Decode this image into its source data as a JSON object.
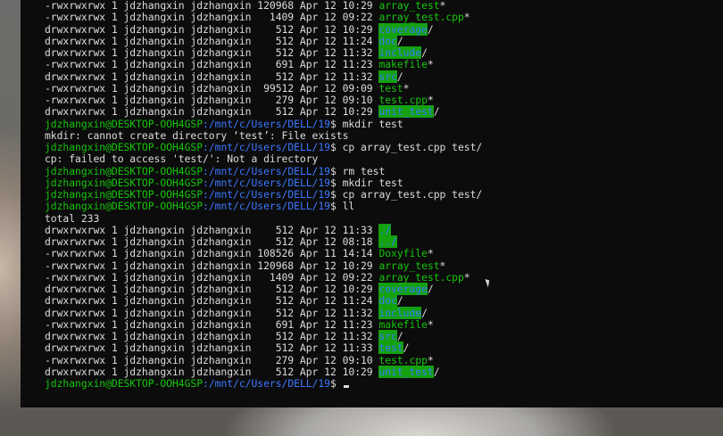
{
  "terminal": {
    "lines": [
      {
        "kind": "entry",
        "meta": "-rwxrwxrwx 1 jdzhangxin jdzhangxin 120968 Apr 12 10:29 ",
        "name": "array_test",
        "ftype": "exec",
        "suffix": "*"
      },
      {
        "kind": "entry",
        "meta": "-rwxrwxrwx 1 jdzhangxin jdzhangxin   1409 Apr 12 09:22 ",
        "name": "array_test.cpp",
        "ftype": "exec",
        "suffix": "*"
      },
      {
        "kind": "entry",
        "meta": "drwxrwxrwx 1 jdzhangxin jdzhangxin    512 Apr 12 10:29 ",
        "name": "coverage",
        "ftype": "dir",
        "suffix": "/"
      },
      {
        "kind": "entry",
        "meta": "drwxrwxrwx 1 jdzhangxin jdzhangxin    512 Apr 12 11:24 ",
        "name": "doc",
        "ftype": "dir",
        "suffix": "/"
      },
      {
        "kind": "entry",
        "meta": "drwxrwxrwx 1 jdzhangxin jdzhangxin    512 Apr 12 11:32 ",
        "name": "include",
        "ftype": "dir",
        "suffix": "/"
      },
      {
        "kind": "entry",
        "meta": "-rwxrwxrwx 1 jdzhangxin jdzhangxin    691 Apr 12 11:23 ",
        "name": "makefile",
        "ftype": "exec",
        "suffix": "*"
      },
      {
        "kind": "entry",
        "meta": "drwxrwxrwx 1 jdzhangxin jdzhangxin    512 Apr 12 11:32 ",
        "name": "src",
        "ftype": "dir",
        "suffix": "/"
      },
      {
        "kind": "entry",
        "meta": "-rwxrwxrwx 1 jdzhangxin jdzhangxin  99512 Apr 12 09:09 ",
        "name": "test",
        "ftype": "exec",
        "suffix": "*"
      },
      {
        "kind": "entry",
        "meta": "-rwxrwxrwx 1 jdzhangxin jdzhangxin    279 Apr 12 09:10 ",
        "name": "test.cpp",
        "ftype": "exec",
        "suffix": "*"
      },
      {
        "kind": "entry",
        "meta": "drwxrwxrwx 1 jdzhangxin jdzhangxin    512 Apr 12 10:29 ",
        "name": "unit_test",
        "ftype": "dir",
        "suffix": "/"
      },
      {
        "kind": "prompt",
        "user": "jdzhangxin@DESKTOP-OOH4GSP",
        "path": ":/mnt/c/Users/DELL/19",
        "cmd": "$ mkdir test"
      },
      {
        "kind": "text",
        "text": "mkdir: cannot create directory ‘test’: File exists"
      },
      {
        "kind": "prompt",
        "user": "jdzhangxin@DESKTOP-OOH4GSP",
        "path": ":/mnt/c/Users/DELL/19",
        "cmd": "$ cp array_test.cpp test/"
      },
      {
        "kind": "text",
        "text": "cp: failed to access 'test/': Not a directory"
      },
      {
        "kind": "prompt",
        "user": "jdzhangxin@DESKTOP-OOH4GSP",
        "path": ":/mnt/c/Users/DELL/19",
        "cmd": "$ rm test"
      },
      {
        "kind": "prompt",
        "user": "jdzhangxin@DESKTOP-OOH4GSP",
        "path": ":/mnt/c/Users/DELL/19",
        "cmd": "$ mkdir test"
      },
      {
        "kind": "prompt",
        "user": "jdzhangxin@DESKTOP-OOH4GSP",
        "path": ":/mnt/c/Users/DELL/19",
        "cmd": "$ cp array_test.cpp test/"
      },
      {
        "kind": "prompt",
        "user": "jdzhangxin@DESKTOP-OOH4GSP",
        "path": ":/mnt/c/Users/DELL/19",
        "cmd": "$ ll"
      },
      {
        "kind": "text",
        "text": "total 233"
      },
      {
        "kind": "entry",
        "meta": "drwxrwxrwx 1 jdzhangxin jdzhangxin    512 Apr 12 11:33 ",
        "name": "./",
        "ftype": "dir",
        "suffix": ""
      },
      {
        "kind": "entry",
        "meta": "drwxrwxrwx 1 jdzhangxin jdzhangxin    512 Apr 12 08:18 ",
        "name": "../",
        "ftype": "dir",
        "suffix": ""
      },
      {
        "kind": "entry",
        "meta": "-rwxrwxrwx 1 jdzhangxin jdzhangxin 108526 Apr 11 14:14 ",
        "name": "Doxyfile",
        "ftype": "exec",
        "suffix": "*"
      },
      {
        "kind": "entry",
        "meta": "-rwxrwxrwx 1 jdzhangxin jdzhangxin 120968 Apr 12 10:29 ",
        "name": "array_test",
        "ftype": "exec",
        "suffix": "*"
      },
      {
        "kind": "entry",
        "meta": "-rwxrwxrwx 1 jdzhangxin jdzhangxin   1409 Apr 12 09:22 ",
        "name": "array_test.cpp",
        "ftype": "exec",
        "suffix": "*"
      },
      {
        "kind": "entry",
        "meta": "drwxrwxrwx 1 jdzhangxin jdzhangxin    512 Apr 12 10:29 ",
        "name": "coverage",
        "ftype": "dir",
        "suffix": "/"
      },
      {
        "kind": "entry",
        "meta": "drwxrwxrwx 1 jdzhangxin jdzhangxin    512 Apr 12 11:24 ",
        "name": "doc",
        "ftype": "dir",
        "suffix": "/"
      },
      {
        "kind": "entry",
        "meta": "drwxrwxrwx 1 jdzhangxin jdzhangxin    512 Apr 12 11:32 ",
        "name": "include",
        "ftype": "dir",
        "suffix": "/"
      },
      {
        "kind": "entry",
        "meta": "-rwxrwxrwx 1 jdzhangxin jdzhangxin    691 Apr 12 11:23 ",
        "name": "makefile",
        "ftype": "exec",
        "suffix": "*"
      },
      {
        "kind": "entry",
        "meta": "drwxrwxrwx 1 jdzhangxin jdzhangxin    512 Apr 12 11:32 ",
        "name": "src",
        "ftype": "dir",
        "suffix": "/"
      },
      {
        "kind": "entry",
        "meta": "drwxrwxrwx 1 jdzhangxin jdzhangxin    512 Apr 12 11:33 ",
        "name": "test",
        "ftype": "dir",
        "suffix": "/"
      },
      {
        "kind": "entry",
        "meta": "-rwxrwxrwx 1 jdzhangxin jdzhangxin    279 Apr 12 09:10 ",
        "name": "test.cpp",
        "ftype": "exec",
        "suffix": "*"
      },
      {
        "kind": "entry",
        "meta": "drwxrwxrwx 1 jdzhangxin jdzhangxin    512 Apr 12 10:29 ",
        "name": "unit_test",
        "ftype": "dir",
        "suffix": "/"
      },
      {
        "kind": "prompt",
        "user": "jdzhangxin@DESKTOP-OOH4GSP",
        "path": ":/mnt/c/Users/DELL/19",
        "cmd": "$ ",
        "cursor": true
      }
    ]
  },
  "colors": {
    "terminal_bg": "#0c0c0c",
    "text": "#dcdcdc",
    "green": "#16c60c",
    "blue": "#3b78ff",
    "dir_highlight": "#13a10e"
  }
}
